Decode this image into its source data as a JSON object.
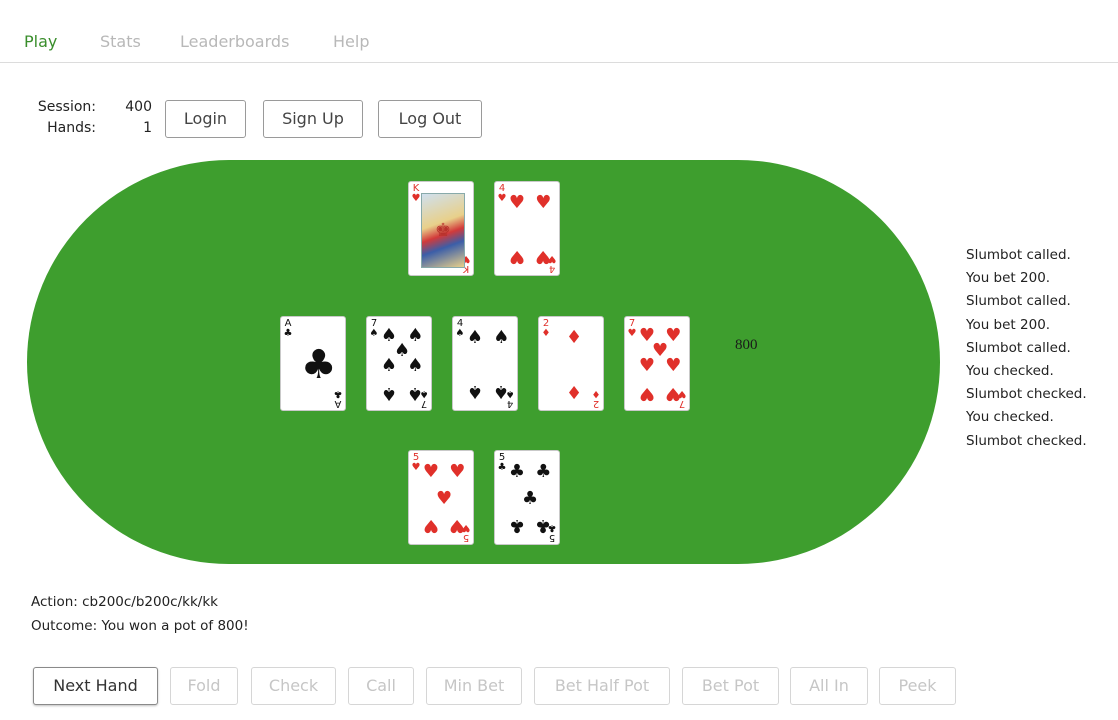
{
  "nav": {
    "items": [
      {
        "label": "Play",
        "active": true
      },
      {
        "label": "Stats",
        "active": false
      },
      {
        "label": "Leaderboards",
        "active": false
      },
      {
        "label": "Help",
        "active": false
      }
    ]
  },
  "session": {
    "session_label": "Session:",
    "session_value": "400",
    "hands_label": "Hands:",
    "hands_value": "1"
  },
  "auth_buttons": {
    "login": "Login",
    "signup": "Sign Up",
    "logout": "Log Out"
  },
  "table": {
    "color": "#3e9e2e",
    "pot": "800",
    "opponent_cards": [
      {
        "rank": "K",
        "suit": "hearts"
      },
      {
        "rank": "4",
        "suit": "hearts"
      }
    ],
    "board_cards": [
      {
        "rank": "A",
        "suit": "clubs"
      },
      {
        "rank": "7",
        "suit": "spades"
      },
      {
        "rank": "4",
        "suit": "spades"
      },
      {
        "rank": "2",
        "suit": "diamonds"
      },
      {
        "rank": "7",
        "suit": "hearts"
      }
    ],
    "player_cards": [
      {
        "rank": "5",
        "suit": "hearts"
      },
      {
        "rank": "5",
        "suit": "clubs"
      }
    ]
  },
  "log": [
    "Slumbot called.",
    "You bet 200.",
    "Slumbot called.",
    "You bet 200.",
    "Slumbot called.",
    "You checked.",
    "Slumbot checked.",
    "You checked.",
    "Slumbot checked."
  ],
  "action": "Action: cb200c/b200c/kk/kk",
  "outcome": "Outcome: You won a pot of 800!",
  "action_buttons": {
    "next_hand": "Next Hand",
    "fold": "Fold",
    "check": "Check",
    "call": "Call",
    "min_bet": "Min Bet",
    "bet_half_pot": "Bet Half Pot",
    "bet_pot": "Bet Pot",
    "all_in": "All In",
    "peek": "Peek"
  }
}
